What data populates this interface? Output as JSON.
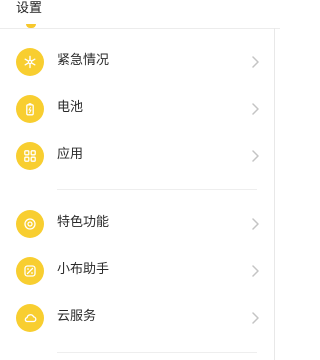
{
  "header": {
    "title": "设置"
  },
  "items": [
    {
      "label": "紧急情况",
      "icon": "emergency-snowflake-icon"
    },
    {
      "label": "电池",
      "icon": "battery-icon"
    },
    {
      "label": "应用",
      "icon": "apps-grid-icon"
    },
    {
      "label": "特色功能",
      "icon": "special-features-icon"
    },
    {
      "label": "小布助手",
      "icon": "assistant-icon"
    },
    {
      "label": "云服务",
      "icon": "cloud-icon"
    }
  ],
  "colors": {
    "accent": "#f8ce30",
    "chevron": "#c4c4c4",
    "text": "#2a2a2a"
  }
}
